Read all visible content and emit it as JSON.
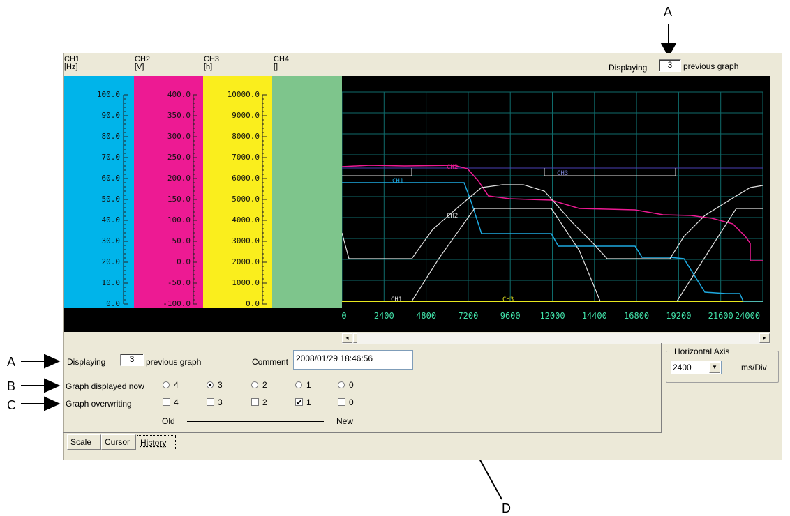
{
  "callouts": {
    "a_top": "A",
    "a_left": "A",
    "b_left": "B",
    "c_left": "C",
    "d_bottom": "D"
  },
  "channels": [
    {
      "name": "CH1",
      "unit": "[Hz]",
      "color": "#00b4ea",
      "ticks": [
        "100.0",
        "90.0",
        "80.0",
        "70.0",
        "60.0",
        "50.0",
        "40.0",
        "30.0",
        "20.0",
        "10.0",
        "0.0"
      ]
    },
    {
      "name": "CH2",
      "unit": "[V]",
      "color": "#ed1a93",
      "ticks": [
        "400.0",
        "350.0",
        "300.0",
        "250.0",
        "200.0",
        "150.0",
        "100.0",
        "50.0",
        "0.0",
        "-50.0",
        "-100.0"
      ]
    },
    {
      "name": "CH3",
      "unit": "[h]",
      "color": "#faee1d",
      "ticks": [
        "10000.0",
        "9000.0",
        "8000.0",
        "7000.0",
        "6000.0",
        "5000.0",
        "4000.0",
        "3000.0",
        "2000.0",
        "1000.0",
        "0.0"
      ]
    },
    {
      "name": "CH4",
      "unit": "[]",
      "color": "#7ec58c",
      "ticks": []
    }
  ],
  "top_display": {
    "label": "Displaying",
    "value": "3",
    "suffix": "previous graph"
  },
  "plot": {
    "x_ticks": [
      "0",
      "2400",
      "4800",
      "7200",
      "9600",
      "12000",
      "14400",
      "16800",
      "19200",
      "21600",
      "24000"
    ],
    "trace_labels": {
      "ch1": "CH1",
      "ch2": "CH2",
      "ch3": "CH3",
      "ch2_white": "CH2",
      "ch1_white": "CH1",
      "ch3_box": "CH3"
    }
  },
  "history": {
    "displaying_label": "Displaying",
    "displaying_value": "3",
    "displaying_suffix": "previous graph",
    "comment_label": "Comment",
    "comment_value": "2008/01/29 18:46:56",
    "graph_now_label": "Graph displayed now",
    "graph_now_options": [
      "4",
      "3",
      "2",
      "1",
      "0"
    ],
    "graph_now_selected": "3",
    "overwrite_label": "Graph overwriting",
    "overwrite_options": [
      "4",
      "3",
      "2",
      "1",
      "0"
    ],
    "overwrite_checked": [
      "1"
    ],
    "old_label": "Old",
    "new_label": "New"
  },
  "horizontal_axis": {
    "title": "Horizontal Axis",
    "value": "2400",
    "unit": "ms/Div"
  },
  "tabs": [
    "Scale",
    "Cursor",
    "History"
  ],
  "selected_tab": "History"
}
